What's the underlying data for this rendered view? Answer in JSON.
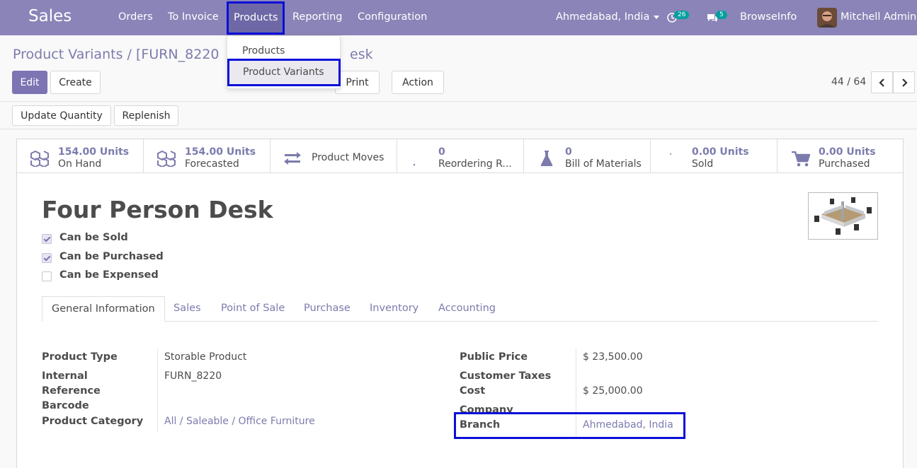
{
  "navbar": {
    "app_name": "Sales",
    "menu": [
      "Orders",
      "To Invoice",
      "Products",
      "Reporting",
      "Configuration"
    ],
    "company": "Ahmedabad, India",
    "activity_count": "26",
    "message_count": "5",
    "browseinfo": "BrowseInfo",
    "user": "Mitchell Admin",
    "accent": "#8b84b8",
    "highlight": "#0b0fd8"
  },
  "dropdown": {
    "items": [
      "Products",
      "Product Variants"
    ]
  },
  "breadcrumb": {
    "parent": "Product Variants",
    "separator": "/",
    "current": "[FURN_8220",
    "tail": "esk"
  },
  "toolbar": {
    "edit": "Edit",
    "create": "Create",
    "print": "Print",
    "action": "Action",
    "update_quantity": "Update Quantity",
    "replenish": "Replenish"
  },
  "pager": {
    "text": "44 / 64"
  },
  "stats": [
    {
      "value": "154.00 Units",
      "label": "On Hand",
      "icon": "cubes-icon"
    },
    {
      "value": "154.00 Units",
      "label": "Forecasted",
      "icon": "cubes-icon"
    },
    {
      "value": "",
      "label": "Product Moves",
      "icon": "exchange-icon"
    },
    {
      "value": "0",
      "label": "Reordering R...",
      "icon": "refresh-icon"
    },
    {
      "value": "0",
      "label": "Bill of Materials",
      "icon": "flask-icon"
    },
    {
      "value": "0.00 Units",
      "label": "Sold",
      "icon": "signal-icon"
    },
    {
      "value": "0.00 Units",
      "label": "Purchased",
      "icon": "cart-icon"
    }
  ],
  "product": {
    "name": "Four Person Desk",
    "can_be_sold": "Can be Sold",
    "can_be_purchased": "Can be Purchased",
    "can_be_expensed": "Can be Expensed"
  },
  "tabs": [
    "General Information",
    "Sales",
    "Point of Sale",
    "Purchase",
    "Inventory",
    "Accounting"
  ],
  "left_fields": {
    "product_type_label": "Product Type",
    "product_type": "Storable Product",
    "internal_ref_label_1": "Internal",
    "internal_ref_label_2": "Reference",
    "internal_ref": "FURN_8220",
    "barcode_label": "Barcode",
    "category_label": "Product Category",
    "category": "All / Saleable / Office Furniture"
  },
  "right_fields": {
    "public_price_label": "Public Price",
    "public_price": "$ 23,500.00",
    "customer_taxes_label": "Customer Taxes",
    "cost_label": "Cost",
    "cost": "$ 25,000.00",
    "company_label": "Company",
    "branch_label": "Branch",
    "branch": "Ahmedabad, India"
  }
}
